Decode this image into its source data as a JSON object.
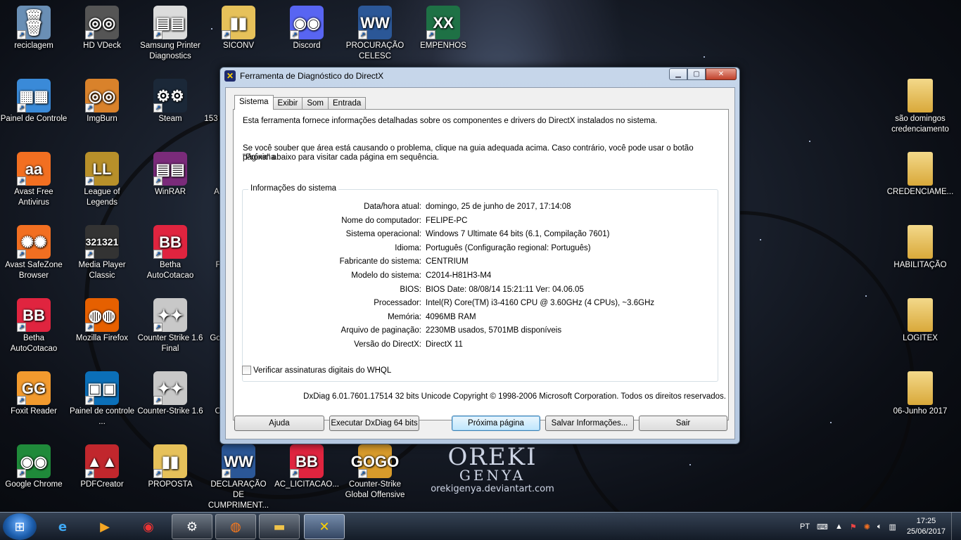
{
  "desktop": {
    "icons_left": [
      {
        "label": "reciclagem",
        "icon": "recycle-bin-icon",
        "symbol": "🗑",
        "color": "#6a8fb5"
      },
      {
        "label": "HD VDeck",
        "icon": "vdeck-icon",
        "symbol": "◎",
        "color": "#555"
      },
      {
        "label": "Samsung Printer Diagnostics",
        "icon": "printer-icon",
        "symbol": "▤",
        "color": "#dcdcdc"
      },
      {
        "label": "SICONV",
        "icon": "folder-icon",
        "symbol": "▮",
        "color": "#e6c15a"
      },
      {
        "label": "Discord",
        "icon": "discord-icon",
        "symbol": "◉",
        "color": "#5865f2"
      },
      {
        "label": "PROCURAÇÃO CELESC",
        "icon": "word-document-icon",
        "symbol": "W",
        "color": "#2b5797"
      },
      {
        "label": "EMPENHOS",
        "icon": "excel-document-icon",
        "symbol": "X",
        "color": "#1e7145"
      },
      {
        "label": "Painel de Controle",
        "icon": "control-panel-icon",
        "symbol": "▦",
        "color": "#3a8ad8"
      },
      {
        "label": "ImgBurn",
        "icon": "imgburn-icon",
        "symbol": "◎",
        "color": "#d9822b"
      },
      {
        "label": "Steam",
        "icon": "steam-icon",
        "symbol": "⚙",
        "color": "#1b2838"
      },
      {
        "label": "Avast Free Antivirus",
        "icon": "avast-icon",
        "symbol": "a",
        "color": "#f26f21"
      },
      {
        "label": "League of Legends",
        "icon": "league-icon",
        "symbol": "L",
        "color": "#b8902a"
      },
      {
        "label": "WinRAR",
        "icon": "winrar-icon",
        "symbol": "▤",
        "color": "#7a2b7a"
      },
      {
        "label": "Avast SafeZone Browser",
        "icon": "safezone-icon",
        "symbol": "✺",
        "color": "#f26f21"
      },
      {
        "label": "Media Player Classic",
        "icon": "mpc-icon",
        "symbol": "321",
        "color": "#333"
      },
      {
        "label": "Betha AutoCotacao",
        "icon": "betha-icon",
        "symbol": "B",
        "color": "#e0243f"
      },
      {
        "label": "Betha AutoCotacao",
        "icon": "betha-icon",
        "symbol": "B",
        "color": "#e0243f"
      },
      {
        "label": "Mozilla Firefox",
        "icon": "firefox-icon",
        "symbol": "◍",
        "color": "#e66000"
      },
      {
        "label": "Counter Strike 1.6 Final",
        "icon": "counter-strike-icon",
        "symbol": "✦",
        "color": "#c8c8c8"
      },
      {
        "label": "Foxit Reader",
        "icon": "foxit-icon",
        "symbol": "G",
        "color": "#f29a2e"
      },
      {
        "label": "Painel de controle ...",
        "icon": "intel-panel-icon",
        "symbol": "▣",
        "color": "#0b6fb8"
      },
      {
        "label": "Counter-Strike 1.6",
        "icon": "counter-strike-icon",
        "symbol": "✦",
        "color": "#c8c8c8"
      },
      {
        "label": "Google Chrome",
        "icon": "chrome-icon",
        "symbol": "◉",
        "color": "#1f8a3a"
      },
      {
        "label": "PDFCreator",
        "icon": "pdfcreator-icon",
        "symbol": "▲",
        "color": "#c1272d"
      },
      {
        "label": "PROPOSTA",
        "icon": "folder-icon",
        "symbol": "▮",
        "color": "#e6c15a"
      },
      {
        "label": "DECLARAÇÃO DE CUMPRIMENT...",
        "icon": "word-document-icon",
        "symbol": "W",
        "color": "#2b5797"
      },
      {
        "label": "AC_LICITACAO...",
        "icon": "betha-icon",
        "symbol": "B",
        "color": "#e0243f"
      },
      {
        "label": "Counter-Strike Global Offensive",
        "icon": "csgo-icon",
        "symbol": "GO",
        "color": "#d89b2b"
      }
    ],
    "icons_right": [
      {
        "label": "são domingos credenciamento",
        "icon": "folder-icon"
      },
      {
        "label": "CREDENCIAME...",
        "icon": "folder-icon"
      },
      {
        "label": "HABILITAÇÃO",
        "icon": "folder-icon"
      },
      {
        "label": "LOGITEX",
        "icon": "folder-icon"
      },
      {
        "label": "06-Junho 2017",
        "icon": "folder-icon"
      }
    ],
    "partial_labels": [
      "153",
      "A",
      "F",
      "Go",
      "O"
    ],
    "wallpaper": {
      "line1": "OREKI",
      "line2": "GENYA",
      "url": "orekigenya.deviantart.com"
    }
  },
  "window": {
    "title": "Ferramenta de Diagnóstico do DirectX",
    "title_icon_symbol": "✕",
    "tabs": [
      "Sistema",
      "Exibir",
      "Som",
      "Entrada"
    ],
    "active_tab": "Sistema",
    "intro1": "Esta ferramenta fornece informações detalhadas sobre os componentes e drivers do DirectX instalados no sistema.",
    "intro2_line1": "Se você souber que área está causando o problema, clique na guia adequada acima. Caso contrário, você pode usar o botão \"Próxima",
    "intro2_line2": "página\" abaixo para visitar cada página em sequência.",
    "group_title": "Informações do sistema",
    "rows": [
      {
        "label": "Data/hora atual:",
        "value": "domingo, 25 de junho de 2017, 17:14:08"
      },
      {
        "label": "Nome do computador:",
        "value": "FELIPE-PC"
      },
      {
        "label": "Sistema operacional:",
        "value": "Windows 7 Ultimate 64 bits (6.1, Compilação 7601)"
      },
      {
        "label": "Idioma:",
        "value": "Português (Configuração regional: Português)"
      },
      {
        "label": "Fabricante do sistema:",
        "value": "CENTRIUM"
      },
      {
        "label": "Modelo do sistema:",
        "value": "C2014-H81H3-M4"
      },
      {
        "label": "BIOS:",
        "value": "BIOS Date: 08/08/14 15:21:11 Ver: 04.06.05"
      },
      {
        "label": "Processador:",
        "value": "Intel(R) Core(TM) i3-4160 CPU @ 3.60GHz (4 CPUs), ~3.6GHz"
      },
      {
        "label": "Memória:",
        "value": "4096MB RAM"
      },
      {
        "label": "Arquivo de paginação:",
        "value": "2230MB usados, 5701MB disponíveis"
      },
      {
        "label": "Versão do DirectX:",
        "value": "DirectX 11"
      }
    ],
    "checkbox_label": "Verificar assinaturas digitais do WHQL",
    "checkbox_checked": false,
    "copyright": "DxDiag 6.01.7601.17514 32 bits Unicode  Copyright © 1998-2006 Microsoft Corporation.  Todos os direitos reservados.",
    "buttons": {
      "help": "Ajuda",
      "run64": "Executar DxDiag 64 bits",
      "next": "Próxima página",
      "save": "Salvar Informações...",
      "exit": "Sair"
    }
  },
  "taskbar": {
    "language": "PT",
    "time": "17:25",
    "date": "25/06/2017",
    "pinned": [
      "internet-explorer-icon",
      "media-player-icon",
      "chrome-icon",
      "steam-icon",
      "firefox-icon",
      "explorer-icon",
      "directx-icon"
    ]
  }
}
